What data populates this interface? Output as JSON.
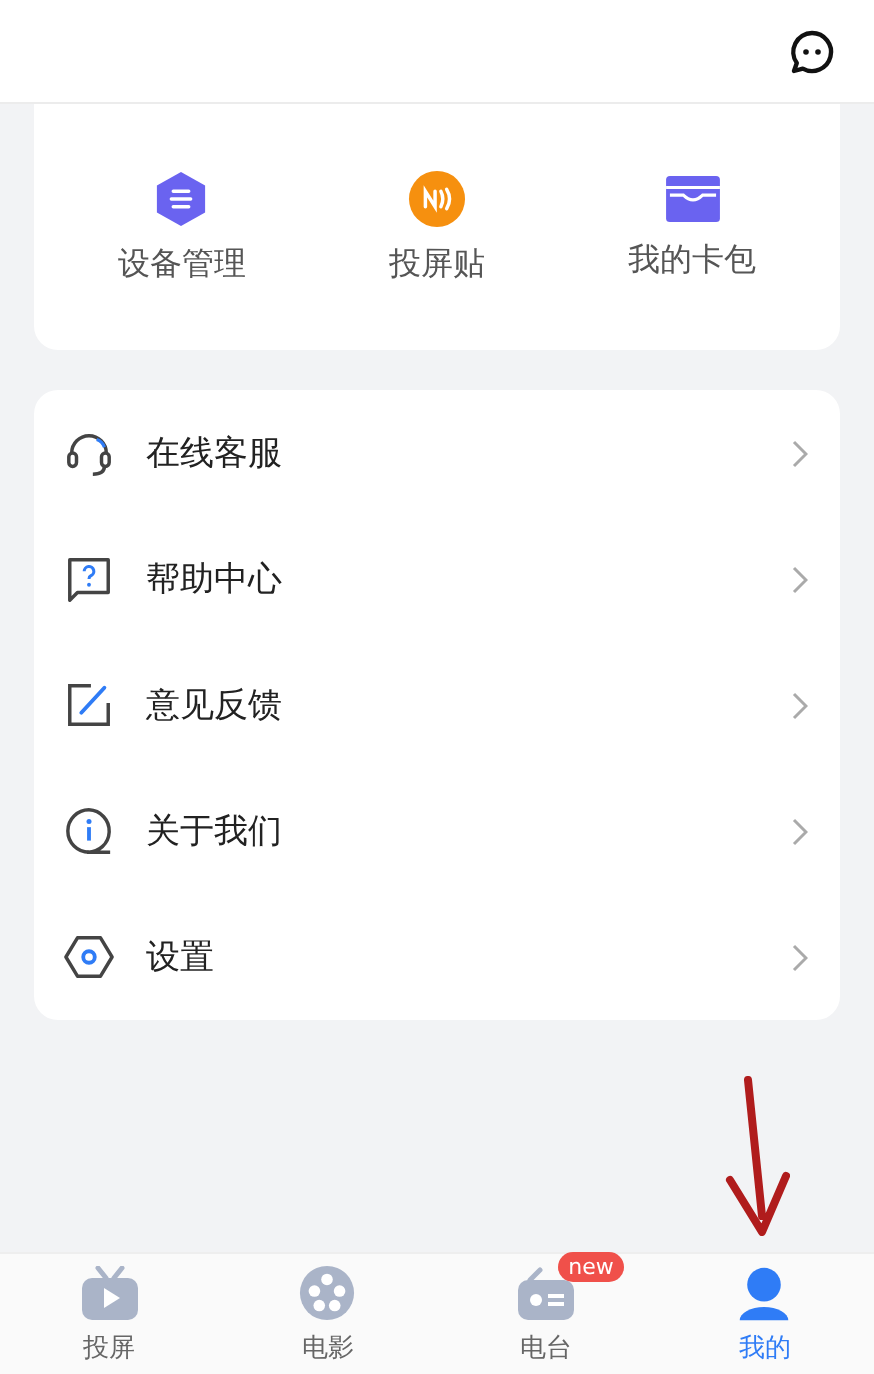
{
  "shortcuts": [
    {
      "label": "设备管理",
      "kind": "device"
    },
    {
      "label": "投屏贴",
      "kind": "nfc"
    },
    {
      "label": "我的卡包",
      "kind": "wallet"
    }
  ],
  "menu": [
    {
      "label": "在线客服",
      "kind": "headset"
    },
    {
      "label": "帮助中心",
      "kind": "help"
    },
    {
      "label": "意见反馈",
      "kind": "feedback"
    },
    {
      "label": "关于我们",
      "kind": "about"
    },
    {
      "label": "设置",
      "kind": "settings"
    }
  ],
  "tabbar": [
    {
      "label": "投屏",
      "kind": "tv",
      "selected": false
    },
    {
      "label": "电影",
      "kind": "film",
      "selected": false
    },
    {
      "label": "电台",
      "kind": "radio",
      "selected": false,
      "badge": "new"
    },
    {
      "label": "我的",
      "kind": "me",
      "selected": true
    }
  ],
  "annotations": [
    {
      "kind": "arrow",
      "color": "#b01c1c"
    }
  ]
}
